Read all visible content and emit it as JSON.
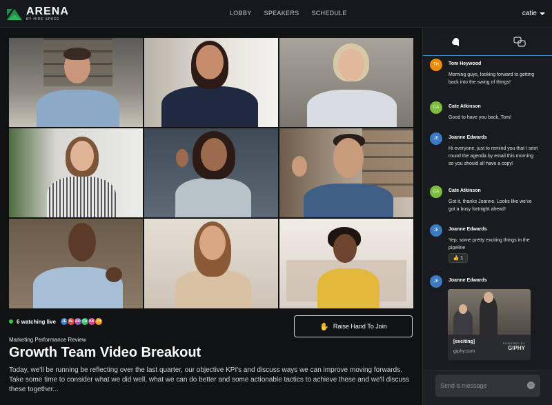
{
  "app": {
    "logo_title": "ARENA",
    "logo_sub": "BY HIRE SPACE",
    "nav": [
      "LOBBY",
      "SPEAKERS",
      "SCHEDULE"
    ],
    "user": "catie"
  },
  "watching": {
    "label": "6 watching live",
    "avatars": [
      {
        "initials": "JE",
        "color": "#3a7bd5"
      },
      {
        "initials": "DL",
        "color": "#e74c3c"
      },
      {
        "initials": "RO",
        "color": "#9b59b6"
      },
      {
        "initials": "CA",
        "color": "#2ecc71"
      },
      {
        "initials": "KN",
        "color": "#e84393"
      },
      {
        "initials": "TH",
        "color": "#f39c12"
      }
    ]
  },
  "raise_hand": "Raise Hand To Join",
  "session": {
    "subtitle": "Marketing Performance Review",
    "title": "Growth Team Video Breakout",
    "description": "Today, we'll be running be reflecting over the last quarter, our objective KPI's and discuss ways we can improve moving forwards. Take some time to consider what we did well, what we can do better and some actionable tactics to achieve these and we'll discuss these together..."
  },
  "chat": {
    "messages": [
      {
        "initials": "TH",
        "color": "#f08c00",
        "name": "Tom Heywood",
        "text": "Morning guys, looking forward to getting back into the swing of things!"
      },
      {
        "initials": "CA",
        "color": "#7dbd3c",
        "name": "Cate Atkinson",
        "text": "Good to have you back, Tom!"
      },
      {
        "initials": "JE",
        "color": "#3a7bc4",
        "name": "Joanne Edwards",
        "text": "Hi everyone, just to remind you that I sent round the agenda by email this morning so you should all have a copy!"
      },
      {
        "initials": "CA",
        "color": "#7dbd3c",
        "name": "Cate Atkinson",
        "text": "Got it, thanks Joanne. Looks like we've got a busy fortnight ahead!"
      },
      {
        "initials": "JE",
        "color": "#3a7bc4",
        "name": "Joanne Edwards",
        "text": "Yep, some pretty exciting things in the pipeline"
      },
      {
        "initials": "JE",
        "color": "#3a7bc4",
        "name": "Joanne Edwards",
        "text": ""
      }
    ],
    "reaction": {
      "emoji": "👍",
      "count": "1"
    },
    "gif": {
      "caption": "[exciting]",
      "source": "giphy.com",
      "powered": "POWERED BY",
      "brand": "GIPHY"
    },
    "placeholder": "Send a message"
  }
}
